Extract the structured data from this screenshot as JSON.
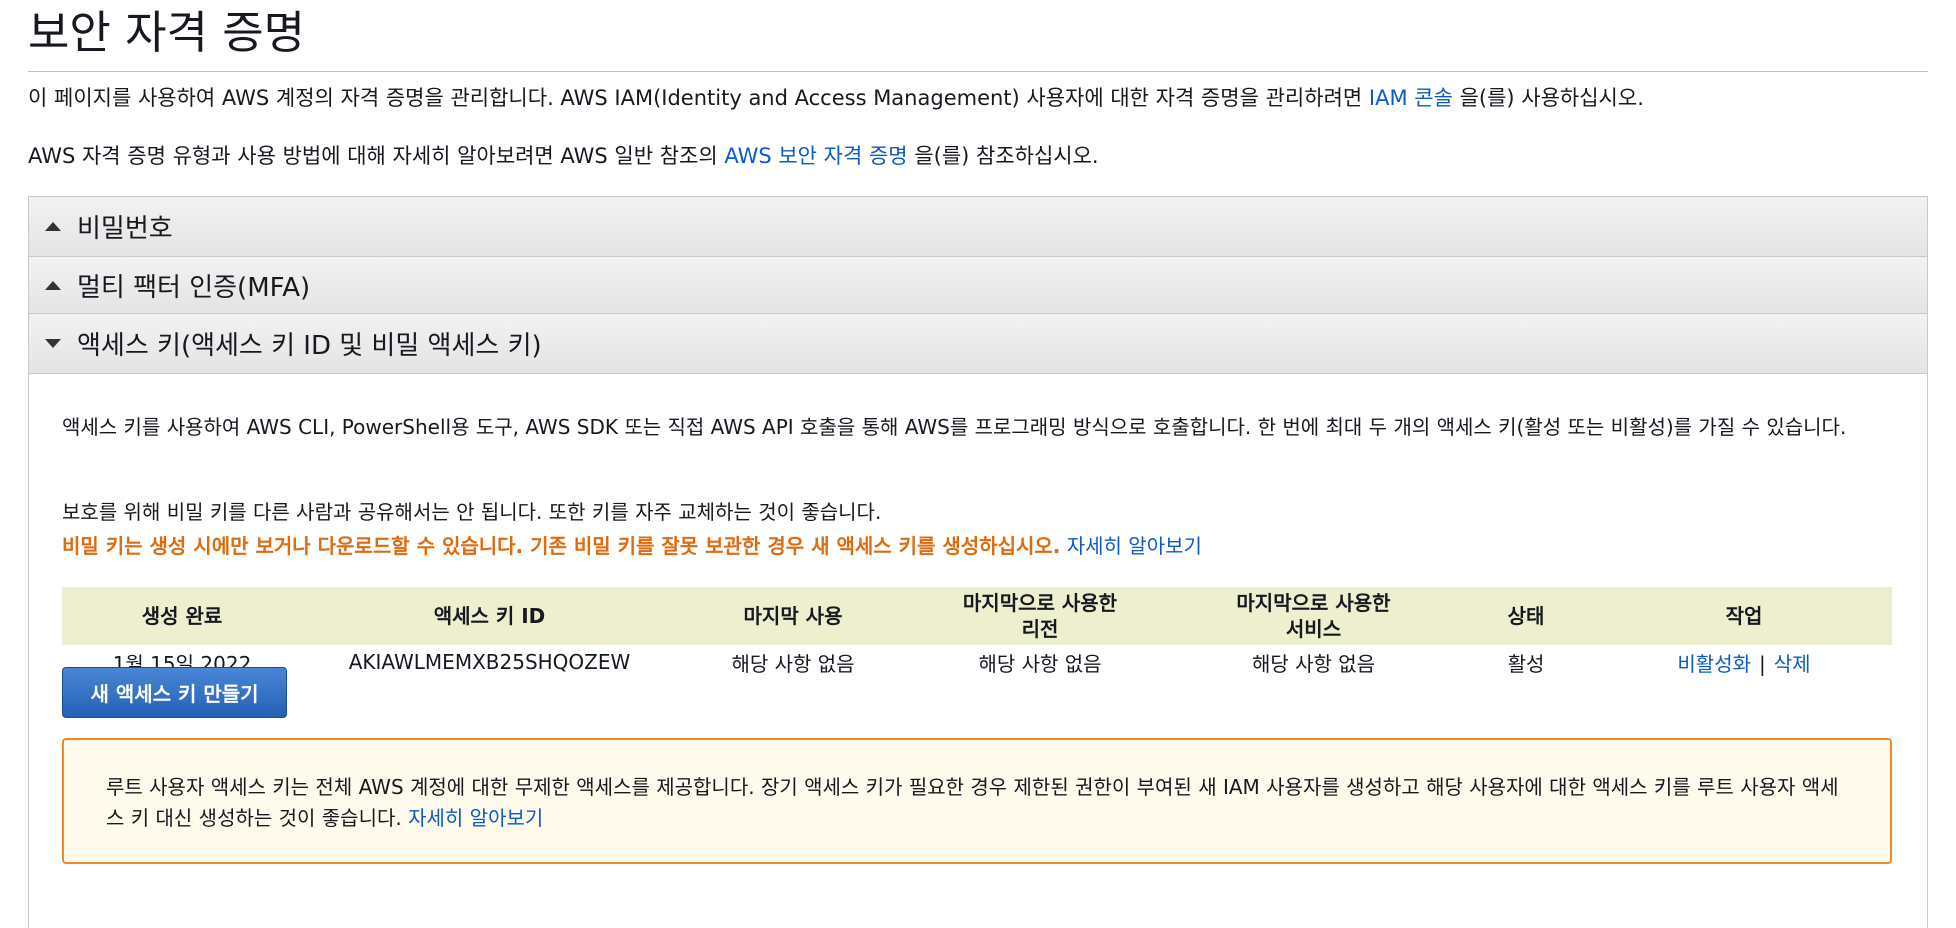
{
  "page": {
    "title": "보안 자격 증명",
    "intro1_prefix": "이 페이지를 사용하여 AWS 계정의 자격 증명을 관리합니다. AWS IAM(Identity and Access Management) 사용자에 대한 자격 증명을 관리하려면 ",
    "intro1_link": "IAM 콘솔",
    "intro1_suffix": " 을(를) 사용하십시오.",
    "intro2_prefix": "AWS 자격 증명 유형과 사용 방법에 대해 자세히 알아보려면 AWS 일반 참조의 ",
    "intro2_link": "AWS 보안 자격 증명",
    "intro2_suffix": " 을(를) 참조하십시오."
  },
  "accordion": {
    "password": "비밀번호",
    "mfa": "멀티 팩터 인증(MFA)",
    "access_keys": "액세스 키(액세스 키 ID 및 비밀 액세스 키)"
  },
  "access_keys": {
    "description": "액세스 키를 사용하여 AWS CLI, PowerShell용 도구, AWS SDK 또는 직접 AWS API 호출을 통해 AWS를 프로그래밍 방식으로 호출합니다. 한 번에 최대 두 개의 액세스 키(활성 또는 비활성)를 가질 수 있습니다.",
    "security_note": "보호를 위해 비밀 키를 다른 사람과 공유해서는 안 됩니다. 또한 키를 자주 교체하는 것이 좋습니다.",
    "warning": "비밀 키는 생성 시에만 보거나 다운로드할 수 있습니다. 기존 비밀 키를 잘못 보관한 경우 새 액세스 키를 생성하십시오.",
    "learn_more": "자세히 알아보기",
    "table": {
      "headers": {
        "created": "생성 완료",
        "key_id": "액세스 키 ID",
        "last_used": "마지막 사용",
        "last_region_1": "마지막으로 사용한",
        "last_region_2": "리전",
        "last_service_1": "마지막으로 사용한",
        "last_service_2": "서비스",
        "status": "상태",
        "actions": "작업"
      },
      "rows": [
        {
          "created": "1월 15일 2022",
          "key_id": "AKIAWLMEMXB25SHQOZEW",
          "last_used": "해당 사항 없음",
          "last_region": "해당 사항 없음",
          "last_service": "해당 사항 없음",
          "status": "활성",
          "deactivate": "비활성화",
          "separator": "|",
          "delete": "삭제"
        }
      ]
    },
    "create_button": "새 액세스 키 만들기",
    "root_notice": "루트 사용자 액세스 키는 전체 AWS 계정에 대한 무제한 액세스를 제공합니다. 장기 액세스 키가 필요한 경우 제한된 권한이 부여된 새 IAM 사용자를 생성하고 해당 사용자에 대한 액세스 키를 루트 사용자 액세스 키 대신 생성하는 것이 좋습니다.",
    "root_notice_link": "자세히 알아보기"
  }
}
